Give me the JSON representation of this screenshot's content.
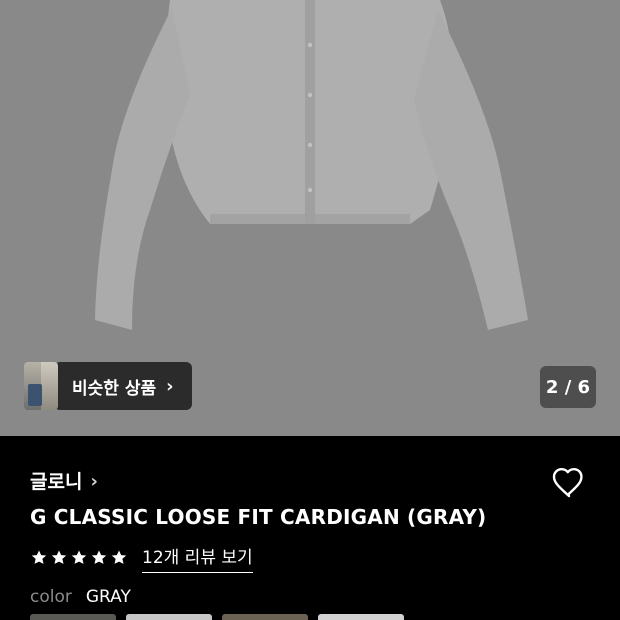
{
  "similar": {
    "label": "비슷한 상품"
  },
  "carousel": {
    "counter": "2 / 6"
  },
  "brand": {
    "name": "글로니"
  },
  "product": {
    "title": "G CLASSIC LOOSE FIT CARDIGAN (GRAY)"
  },
  "rating": {
    "stars": 5,
    "review_link": "12개 리뷰 보기"
  },
  "color": {
    "key": "color",
    "value": "GRAY"
  },
  "palette": {
    "bg_hero": "#8f8f8f",
    "cardigan": "#b4b4b4"
  },
  "icons": {
    "chevron": "chevron-right-icon",
    "heart": "heart-outline-icon",
    "star": "star-icon"
  }
}
